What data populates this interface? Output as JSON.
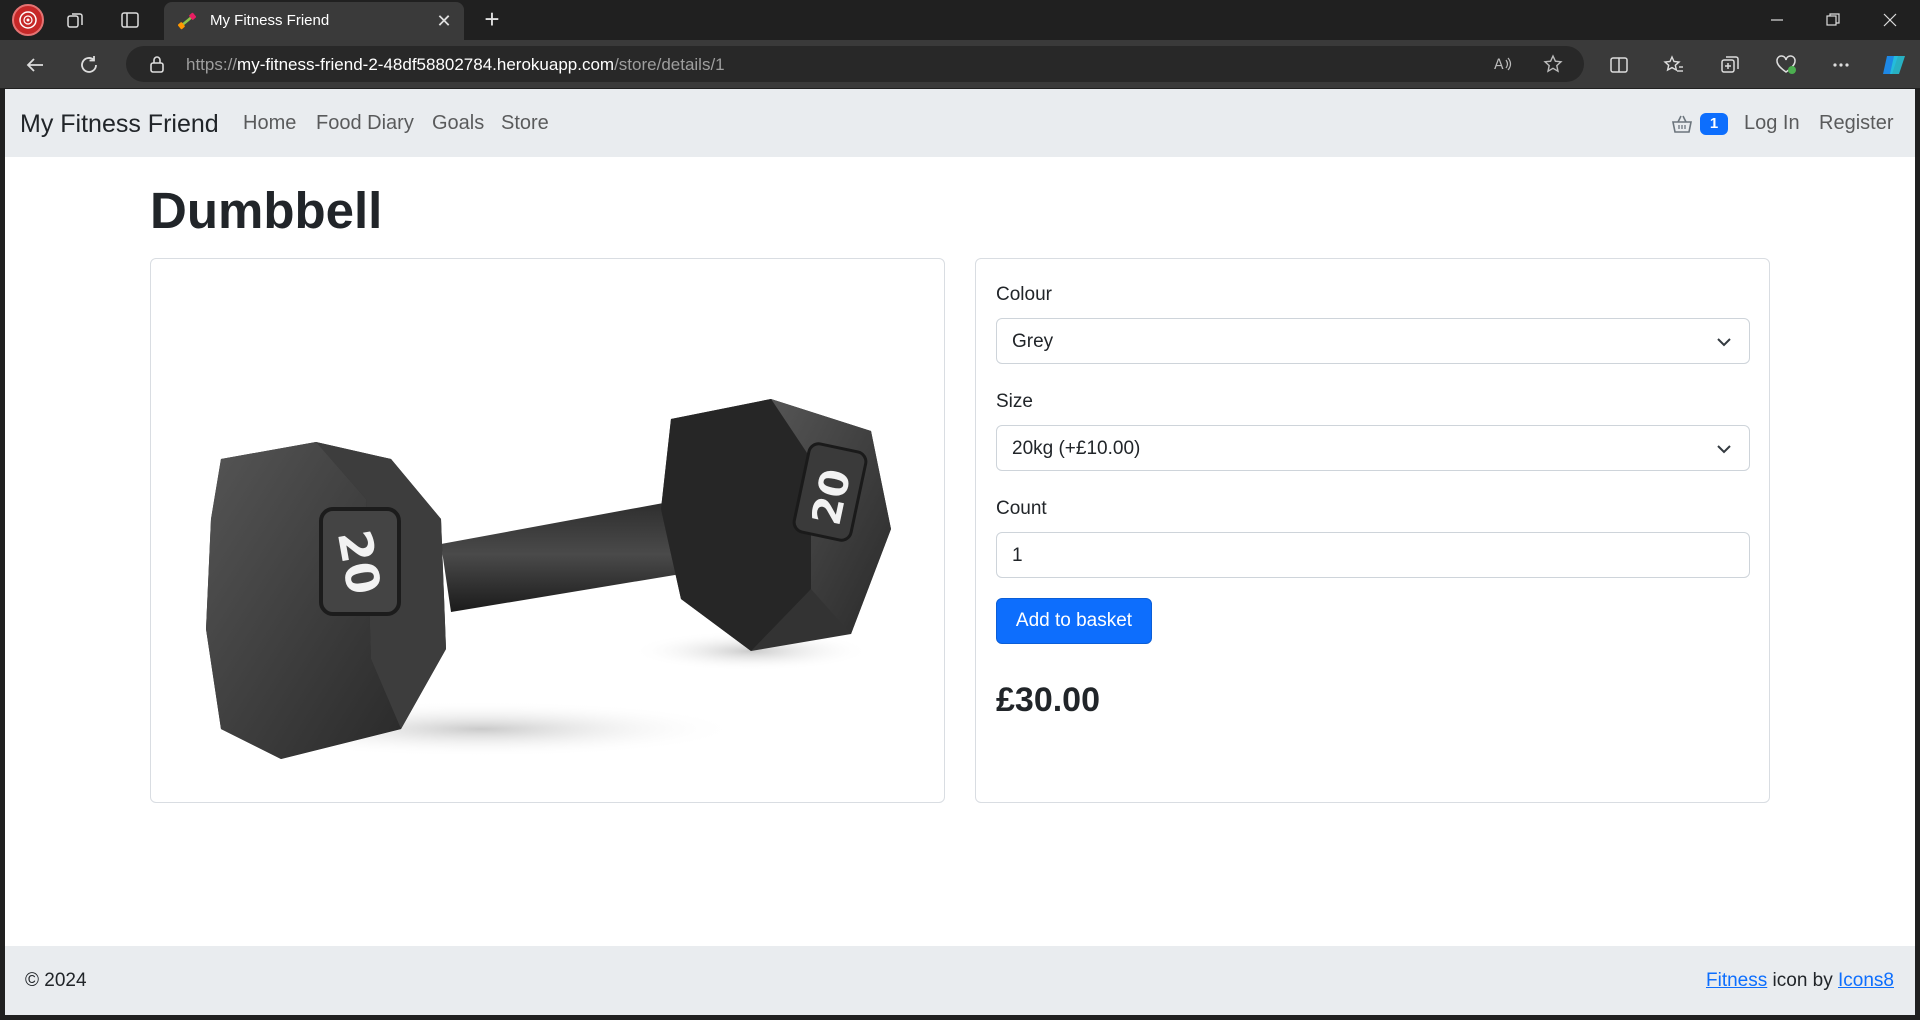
{
  "browser": {
    "tab_title": "My Fitness Friend",
    "url_scheme": "https://",
    "url_host": "my-fitness-friend-2-48df58802784.herokuapp.com",
    "url_path": "/store/details/1"
  },
  "navbar": {
    "brand": "My Fitness Friend",
    "links": [
      "Home",
      "Food Diary",
      "Goals",
      "Store"
    ],
    "basket_count": "1",
    "login": "Log In",
    "register": "Register"
  },
  "product": {
    "name": "Dumbbell",
    "image_icon": "dumbbell-image",
    "image_digits": "20"
  },
  "form": {
    "colour_label": "Colour",
    "colour_value": "Grey",
    "size_label": "Size",
    "size_value": "20kg (+£10.00)",
    "count_label": "Count",
    "count_value": "1",
    "add_button": "Add to basket",
    "price": "£30.00"
  },
  "footer": {
    "copyright": "© 2024",
    "credit_link1": "Fitness",
    "credit_middle": " icon by ",
    "credit_link2": "Icons8"
  },
  "colors": {
    "primary": "#0d6efd",
    "navbar_bg": "#e9ecef",
    "chrome_dark": "#202020"
  }
}
